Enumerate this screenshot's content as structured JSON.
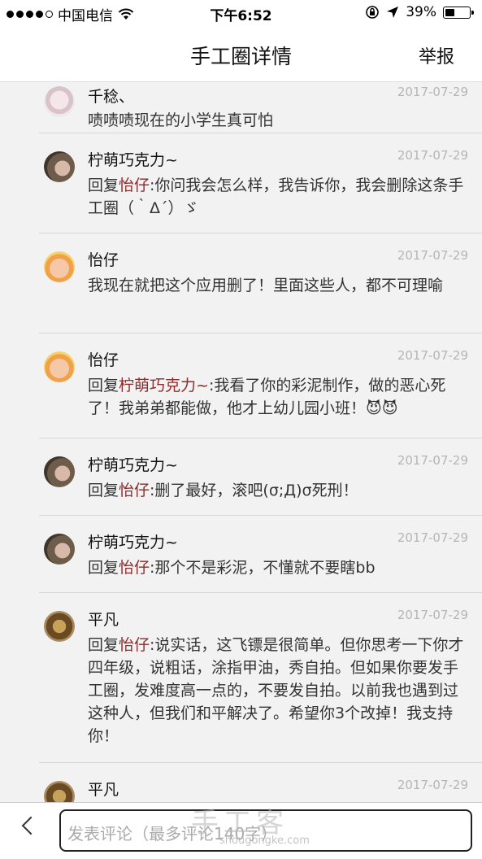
{
  "status_bar": {
    "carrier": "中国电信",
    "time": "下午6:52",
    "battery_percent": "39%",
    "battery_level": 0.39
  },
  "nav": {
    "title": "手工圈详情",
    "report": "举报"
  },
  "comments": [
    {
      "name": "千稔、",
      "date": "2017-07-29",
      "reply_prefix": "",
      "mention": "",
      "text": "啧啧啧现在的小学生真可怕"
    },
    {
      "name": "柠萌巧克力~",
      "date": "2017-07-29",
      "reply_prefix": "回复",
      "mention": "怡仔",
      "text": ":你问我会怎么样，我告诉你，我会删除这条手工圈（｀Δ´）ゞ"
    },
    {
      "name": "怡仔",
      "date": "2017-07-29",
      "reply_prefix": "",
      "mention": "",
      "text": "我现在就把这个应用删了！里面这些人，都不可理喻"
    },
    {
      "name": "怡仔",
      "date": "2017-07-29",
      "reply_prefix": "回复",
      "mention": "柠萌巧克力~",
      "text": ":我看了你的彩泥制作，做的恶心死了！我弟弟都能做，他才上幼儿园小班！😈😈"
    },
    {
      "name": "柠萌巧克力~",
      "date": "2017-07-29",
      "reply_prefix": "回复",
      "mention": "怡仔",
      "text": ":删了最好，滚吧(σ;Д)σ死刑！"
    },
    {
      "name": "柠萌巧克力~",
      "date": "2017-07-29",
      "reply_prefix": "回复",
      "mention": "怡仔",
      "text": ":那个不是彩泥，不懂就不要瞎bb"
    },
    {
      "name": "平凡",
      "date": "2017-07-29",
      "reply_prefix": "回复",
      "mention": "怡仔",
      "text": ":说实话，这飞镖是很简单。但你思考一下你才四年级，说粗话，涂指甲油，秀自拍。但如果你要发手工圈，发难度高一点的，不要发自拍。以前我也遇到过这种人，但我们和平解决了。希望你3个改掉！我支持你！"
    },
    {
      "name": "平凡",
      "date": "2017-07-29",
      "reply_prefix": "",
      "mention": "",
      "text": ""
    }
  ],
  "bottom_bar": {
    "input_placeholder": "发表评论（最多评论140字）"
  },
  "watermark": {
    "text": "手工客",
    "url": "shougongke.com"
  }
}
